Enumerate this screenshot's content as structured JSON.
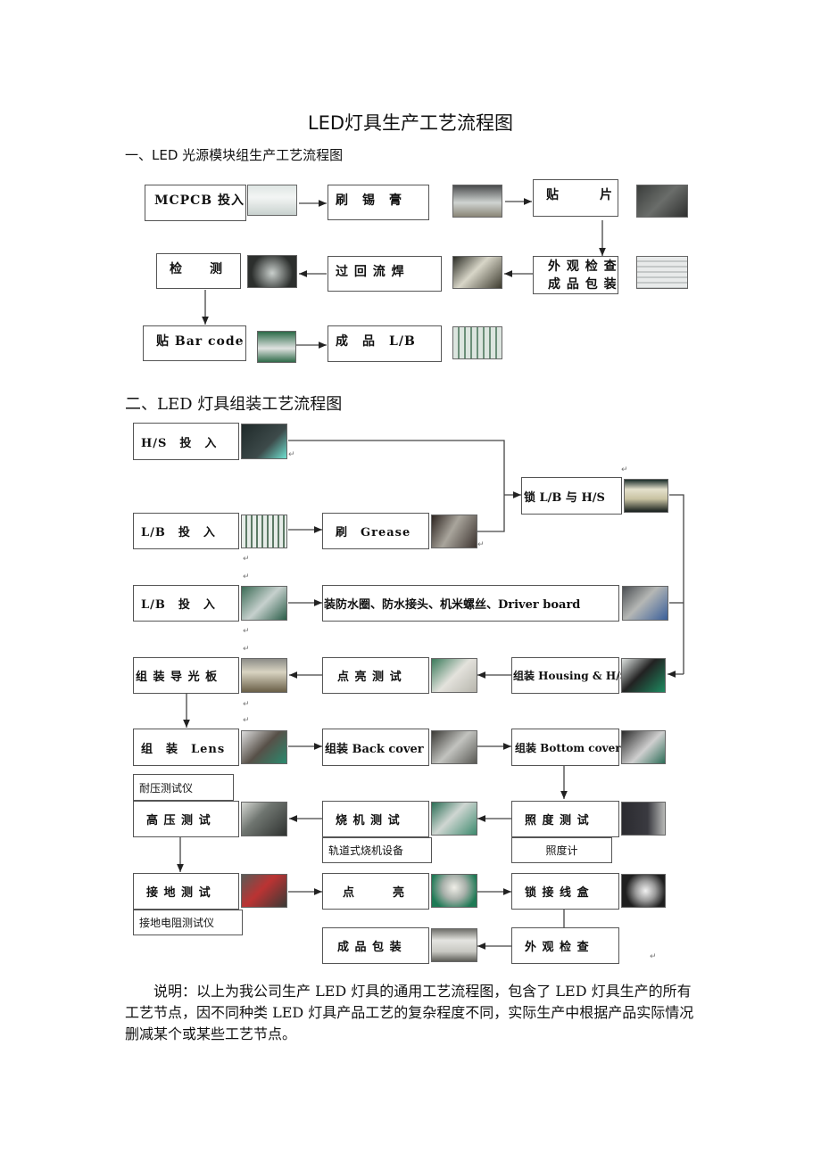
{
  "title": "LED灯具生产工艺流程图",
  "section1": {
    "heading": "一、LED 光源模块组生产工艺流程图",
    "steps": [
      {
        "label": "MCPCB 投入"
      },
      {
        "label": "刷　锡　膏"
      },
      {
        "label": "贴　　　片"
      },
      {
        "label": "外 观 检 查",
        "label2": "成 品 包 装"
      },
      {
        "label": "过 回 流 焊"
      },
      {
        "label": "检　　测"
      },
      {
        "label": "贴 Bar code"
      },
      {
        "label": "成　品　L/B"
      }
    ]
  },
  "section2": {
    "heading": "二、LED 灯具组装工艺流程图",
    "steps": [
      {
        "label": "H/S　投　入"
      },
      {
        "label": "L/B　投　入"
      },
      {
        "label": "刷　Grease"
      },
      {
        "label": "锁 L/B 与 H/S"
      },
      {
        "label": "L/B　投　入"
      },
      {
        "label": "装防水圈、防水接头、机米螺丝、Driver board"
      },
      {
        "label": "组 装 导 光 板"
      },
      {
        "label": "点 亮 测 试"
      },
      {
        "label": "组装 Housing & H/S"
      },
      {
        "label": "组　装　Lens"
      },
      {
        "label": "组装 Back cover"
      },
      {
        "label": "组装 Bottom cover"
      },
      {
        "label": "高 压 测 试"
      },
      {
        "label": "烧 机 测 试"
      },
      {
        "label": "照 度 测 试"
      },
      {
        "label": "接 地 测 试"
      },
      {
        "label": "点　　　亮"
      },
      {
        "label": "锁 接 线 盒"
      },
      {
        "label": "成 品 包 装"
      },
      {
        "label": "外 观 检 查"
      }
    ],
    "notes": {
      "hipot": "耐压测试仪",
      "burnin": "轨道式烧机设备",
      "lux": "照度计",
      "ground": "接地电阻测试仪"
    }
  },
  "description": "说明：以上为我公司生产 LED 灯具的通用工艺流程图，包含了 LED 灯具生产的所有工艺节点，因不同种类 LED 灯具产品工艺的复杂程度不同，实际生产中根据产品实际情况删减某个或某些工艺节点。",
  "pilcrow": "↵"
}
